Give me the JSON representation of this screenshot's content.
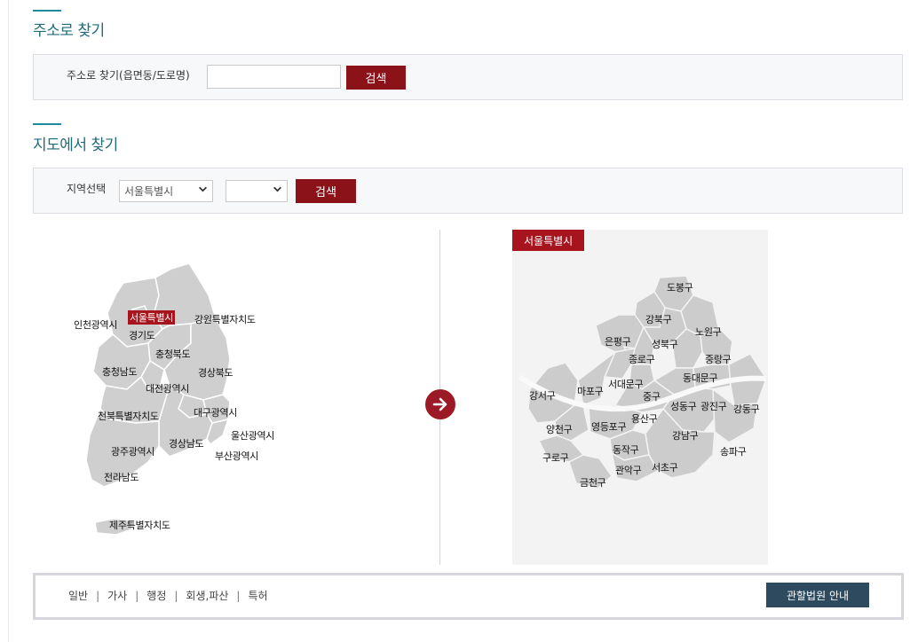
{
  "address_search": {
    "title": "주소로 찾기",
    "label": "주소로 찾기(읍면동/도로명)",
    "input_value": "",
    "button_label": "검색"
  },
  "map_search": {
    "title": "지도에서 찾기",
    "region_label": "지역선택",
    "region_select_value": "서울특별시",
    "district_select_value": "",
    "button_label": "검색"
  },
  "korea_map": {
    "regions": [
      "인천광역시",
      "서울특별시",
      "강원특별자치도",
      "경기도",
      "충청북도",
      "충청남도",
      "경상북도",
      "대전광역시",
      "대구광역시",
      "전북특별자치도",
      "울산광역시",
      "경상남도",
      "광주광역시",
      "부산광역시",
      "전라남도",
      "제주특별자치도"
    ],
    "selected": "서울특별시"
  },
  "seoul_map": {
    "tag": "서울특별시",
    "districts": [
      "도봉구",
      "강북구",
      "노원구",
      "은평구",
      "성북구",
      "종로구",
      "중랑구",
      "서대문구",
      "동대문구",
      "강서구",
      "마포구",
      "중구",
      "성동구",
      "광진구",
      "강동구",
      "용산구",
      "양천구",
      "영등포구",
      "강남구",
      "구로구",
      "동작구",
      "송파구",
      "관악구",
      "서초구",
      "금천구"
    ]
  },
  "footer": {
    "categories": [
      "일반",
      "가사",
      "행정",
      "회생,파산",
      "특허"
    ],
    "separator": "|",
    "guide_button": "관할법원 안내"
  },
  "colors": {
    "accent": "#8b1219",
    "title": "#1f6b78",
    "map_land": "#cfcfcf",
    "guide_button": "#2d4a5e"
  },
  "icons": {
    "arrow": "arrow-right-circle-icon",
    "dropdown": "chevron-down-icon"
  }
}
